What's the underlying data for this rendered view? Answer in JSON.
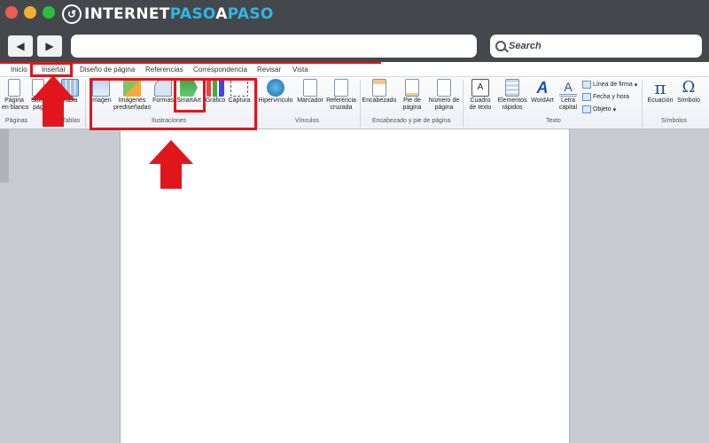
{
  "browser": {
    "logo": {
      "part1": "INTERNET",
      "part2": "PASO",
      "part3": "A",
      "part4": "PASO"
    },
    "nav": {
      "back": "◀",
      "forward": "▶"
    },
    "search_placeholder": "Search"
  },
  "tabs": [
    "Inicio",
    "Insertar",
    "Diseño de página",
    "Referencias",
    "Correspondencia",
    "Revisar",
    "Vista"
  ],
  "groups": {
    "paginas": "Páginas",
    "tablas": "Tablas",
    "ilustraciones": "Ilustraciones",
    "vinculos": "Vínculos",
    "encabezado": "Encabezado y pie de página",
    "texto": "Texto",
    "simbolos": "Símbolos"
  },
  "buttons": {
    "pagina_en_blanco_1": "Página",
    "pagina_en_blanco_2": "en blanco",
    "salto_1": "Salto",
    "salto_2": "pág",
    "tabla": "Tabla",
    "imagen": "Imagen",
    "imagenes_1": "Imágenes",
    "imagenes_2": "prediseñadas",
    "formas": "Formas",
    "smartart": "SmartArt",
    "grafico": "Gráfico",
    "captura": "Captura",
    "hipervinculo": "Hipervínculo",
    "marcador": "Marcador",
    "referencia_1": "Referencia",
    "referencia_2": "cruzada",
    "encabezado": "Encabezado",
    "pie_1": "Pie de",
    "pie_2": "página",
    "numero_1": "Número de",
    "numero_2": "página",
    "cuadro_1": "Cuadro",
    "cuadro_2": "de texto",
    "elementos_1": "Elementos",
    "elementos_2": "rápidos",
    "wordart": "WordArt",
    "letra_1": "Letra",
    "letra_2": "capital",
    "linea_firma": "Línea de firma",
    "fecha_hora": "Fecha y hora",
    "objeto": "Objeto",
    "ecuacion": "Ecuación",
    "simbolo": "Símbolo"
  },
  "colors": {
    "highlight": "#e0161c",
    "chrome": "#44484d",
    "accent": "#2fb6e3"
  }
}
